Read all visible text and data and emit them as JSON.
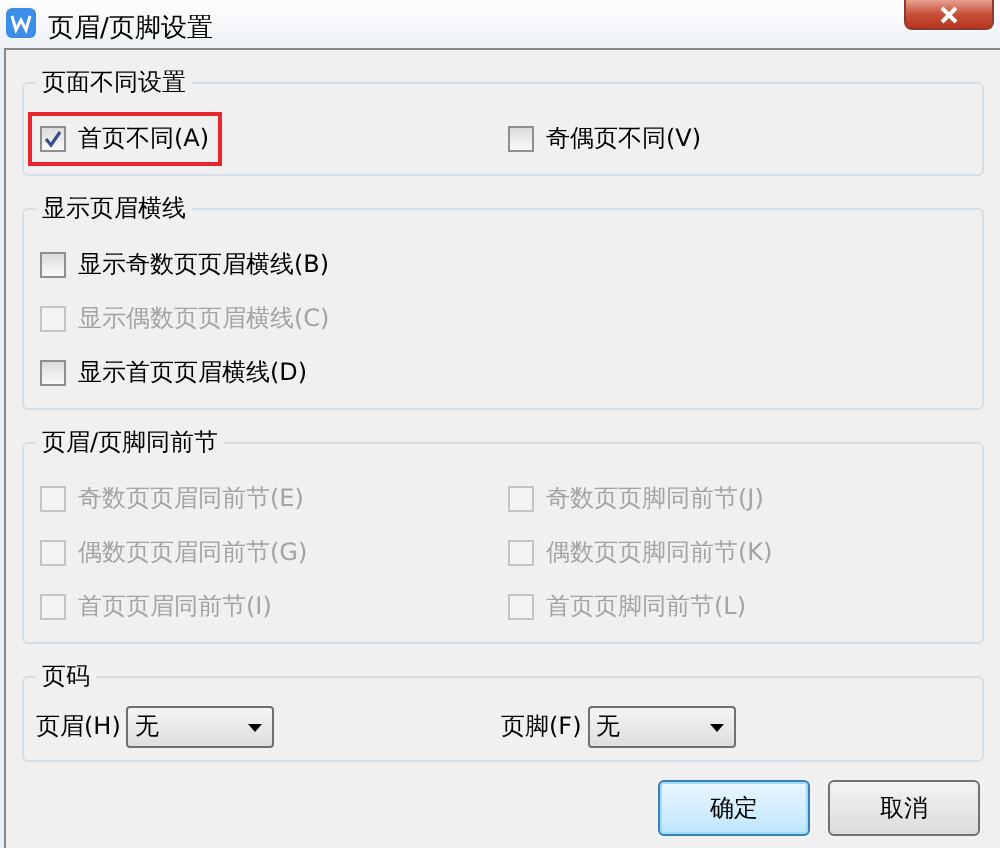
{
  "window": {
    "title": "页眉/页脚设置"
  },
  "groups": [
    {
      "title": "页面不同设置",
      "kind": "two-column",
      "items": [
        {
          "label": "首页不同(A)",
          "checked": true,
          "disabled": false,
          "highlighted": true
        },
        {
          "label": "奇偶页不同(V)",
          "checked": false,
          "disabled": false,
          "highlighted": false
        }
      ]
    },
    {
      "title": "显示页眉横线",
      "kind": "one-column",
      "items": [
        {
          "label": "显示奇数页页眉横线(B)",
          "checked": false,
          "disabled": false,
          "highlighted": false
        },
        {
          "label": "显示偶数页页眉横线(C)",
          "checked": false,
          "disabled": true,
          "highlighted": false
        },
        {
          "label": "显示首页页眉横线(D)",
          "checked": false,
          "disabled": false,
          "highlighted": false
        }
      ]
    },
    {
      "title": "页眉/页脚同前节",
      "kind": "two-column",
      "items": [
        {
          "label": "奇数页页眉同前节(E)",
          "checked": false,
          "disabled": true,
          "highlighted": false
        },
        {
          "label": "奇数页页脚同前节(J)",
          "checked": false,
          "disabled": true,
          "highlighted": false
        },
        {
          "label": "偶数页页眉同前节(G)",
          "checked": false,
          "disabled": true,
          "highlighted": false
        },
        {
          "label": "偶数页页脚同前节(K)",
          "checked": false,
          "disabled": true,
          "highlighted": false
        },
        {
          "label": "首页页眉同前节(I)",
          "checked": false,
          "disabled": true,
          "highlighted": false
        },
        {
          "label": "首页页脚同前节(L)",
          "checked": false,
          "disabled": true,
          "highlighted": false
        }
      ]
    }
  ],
  "page_numbers": {
    "title": "页码",
    "fields": [
      {
        "label": "页眉(H)",
        "value": "无"
      },
      {
        "label": "页脚(F)",
        "value": "无"
      }
    ]
  },
  "buttons": [
    {
      "label": "确定",
      "default": true
    },
    {
      "label": "取消",
      "default": false
    }
  ]
}
